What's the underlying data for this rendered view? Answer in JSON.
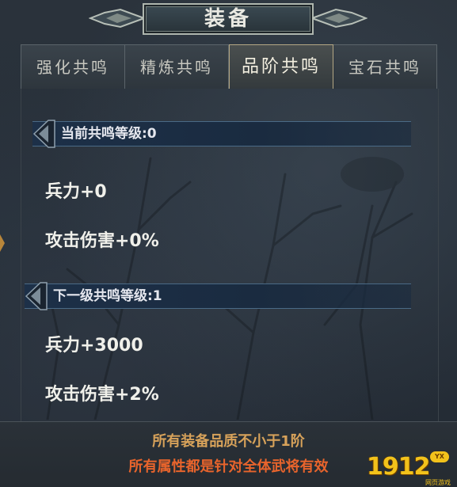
{
  "title": "装备",
  "tabs": [
    {
      "label": "强化共鸣",
      "active": false
    },
    {
      "label": "精炼共鸣",
      "active": false
    },
    {
      "label": "品阶共鸣",
      "active": true
    },
    {
      "label": "宝石共鸣",
      "active": false
    }
  ],
  "current": {
    "header": "当前共鸣等级:0",
    "stats": [
      "兵力+0",
      "攻击伤害+0%"
    ]
  },
  "next": {
    "header": "下一级共鸣等级:1",
    "stats": [
      "兵力+3000",
      "攻击伤害+2%"
    ]
  },
  "footer": {
    "requirement": "所有装备品质不小于1阶",
    "note": "所有属性都是针对全体武将有效"
  },
  "watermark": {
    "text": "1912",
    "badge": "YX",
    "sub": "网页游戏"
  },
  "colors": {
    "requirement": "#d7a25a",
    "note": "#e8642c",
    "header_bg": "#1d3048",
    "logo": "#f2c21b"
  },
  "icons": [
    "title-ornament-left-icon",
    "title-ornament-right-icon",
    "section-arrow-icon"
  ]
}
